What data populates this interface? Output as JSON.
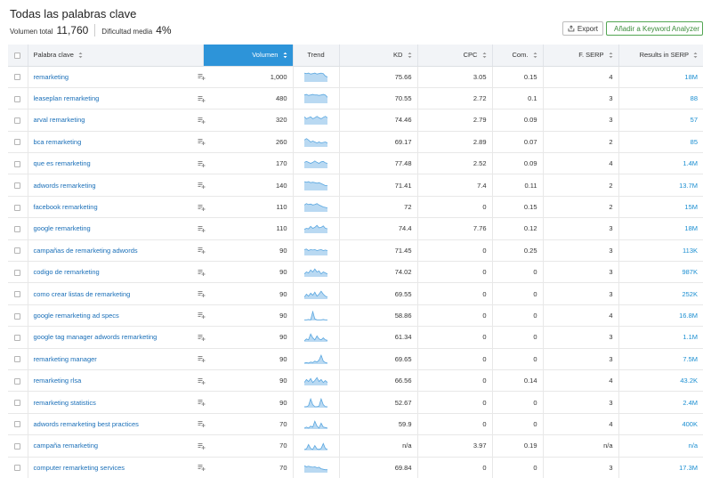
{
  "header": {
    "title": "Todas las palabras clave",
    "total_volume_label": "Volumen total",
    "total_volume_value": "11,760",
    "avg_difficulty_label": "Dificultad media",
    "avg_difficulty_value": "4%"
  },
  "toolbar": {
    "export_label": "Export",
    "add_label": "Añadir a Keyword Analyzer"
  },
  "table": {
    "columns": {
      "keyword": "Palabra clave",
      "volume": "Volumen",
      "trend": "Trend",
      "kd": "KD",
      "cpc": "CPC",
      "com": "Com.",
      "serp": "F. SERP",
      "results": "Results in SERP"
    },
    "rows": [
      {
        "keyword": "remarketing",
        "volume": "1,000",
        "kd": "75.66",
        "cpc": "3.05",
        "com": "0.15",
        "serp": "4",
        "results": "18M",
        "trend": [
          0.9,
          0.85,
          0.9,
          0.8,
          0.85,
          0.9,
          0.8,
          0.85,
          0.9,
          0.85,
          0.6,
          0.5
        ]
      },
      {
        "keyword": "leaseplan remarketing",
        "volume": "480",
        "kd": "70.55",
        "cpc": "2.72",
        "com": "0.1",
        "serp": "3",
        "results": "88",
        "trend": [
          0.85,
          0.9,
          0.8,
          0.85,
          0.9,
          0.85,
          0.85,
          0.8,
          0.85,
          0.9,
          0.85,
          0.6
        ]
      },
      {
        "keyword": "arval remarketing",
        "volume": "320",
        "kd": "74.46",
        "cpc": "2.79",
        "com": "0.09",
        "serp": "3",
        "results": "57",
        "trend": [
          0.8,
          0.6,
          0.7,
          0.8,
          0.6,
          0.7,
          0.85,
          0.7,
          0.6,
          0.75,
          0.85,
          0.7
        ]
      },
      {
        "keyword": "bca remarketing",
        "volume": "260",
        "kd": "69.17",
        "cpc": "2.89",
        "com": "0.07",
        "serp": "2",
        "results": "85",
        "trend": [
          0.7,
          0.85,
          0.7,
          0.5,
          0.6,
          0.5,
          0.4,
          0.5,
          0.4,
          0.45,
          0.5,
          0.4
        ]
      },
      {
        "keyword": "que es remarketing",
        "volume": "170",
        "kd": "77.48",
        "cpc": "2.52",
        "com": "0.09",
        "serp": "4",
        "results": "1.4M",
        "trend": [
          0.6,
          0.7,
          0.6,
          0.5,
          0.6,
          0.75,
          0.6,
          0.5,
          0.65,
          0.7,
          0.55,
          0.5
        ]
      },
      {
        "keyword": "adwords remarketing",
        "volume": "140",
        "kd": "71.41",
        "cpc": "7.4",
        "com": "0.11",
        "serp": "2",
        "results": "13.7M",
        "trend": [
          0.9,
          0.85,
          0.9,
          0.8,
          0.85,
          0.8,
          0.75,
          0.8,
          0.7,
          0.6,
          0.5,
          0.5
        ]
      },
      {
        "keyword": "facebook remarketing",
        "volume": "110",
        "kd": "72",
        "cpc": "0",
        "com": "0.15",
        "serp": "2",
        "results": "15M",
        "trend": [
          0.7,
          0.85,
          0.75,
          0.8,
          0.7,
          0.75,
          0.85,
          0.7,
          0.6,
          0.5,
          0.45,
          0.4
        ]
      },
      {
        "keyword": "google remarketing",
        "volume": "110",
        "kd": "74.4",
        "cpc": "7.76",
        "com": "0.12",
        "serp": "3",
        "results": "18M",
        "trend": [
          0.4,
          0.5,
          0.45,
          0.7,
          0.5,
          0.6,
          0.8,
          0.55,
          0.6,
          0.75,
          0.5,
          0.45
        ]
      },
      {
        "keyword": "campañas de remarketing adwords",
        "volume": "90",
        "kd": "71.45",
        "cpc": "0",
        "com": "0.25",
        "serp": "3",
        "results": "113K",
        "trend": [
          0.6,
          0.65,
          0.5,
          0.6,
          0.55,
          0.6,
          0.5,
          0.55,
          0.6,
          0.5,
          0.55,
          0.5
        ]
      },
      {
        "keyword": "codigo de remarketing",
        "volume": "90",
        "kd": "74.02",
        "cpc": "0",
        "com": "0",
        "serp": "3",
        "results": "987K",
        "trend": [
          0.3,
          0.5,
          0.4,
          0.7,
          0.5,
          0.8,
          0.5,
          0.6,
          0.3,
          0.5,
          0.4,
          0.3
        ]
      },
      {
        "keyword": "como crear listas de remarketing",
        "volume": "90",
        "kd": "69.55",
        "cpc": "0",
        "com": "0",
        "serp": "3",
        "results": "252K",
        "trend": [
          0.2,
          0.5,
          0.3,
          0.6,
          0.4,
          0.7,
          0.3,
          0.5,
          0.8,
          0.5,
          0.3,
          0.2
        ]
      },
      {
        "keyword": "google remarketing ad specs",
        "volume": "90",
        "kd": "58.86",
        "cpc": "0",
        "com": "0",
        "serp": "4",
        "results": "16.8M",
        "trend": [
          0.05,
          0.05,
          0.1,
          0.05,
          0.9,
          0.15,
          0.05,
          0.05,
          0.05,
          0.1,
          0.05,
          0.05
        ]
      },
      {
        "keyword": "google tag manager adwords remarketing",
        "volume": "90",
        "kd": "61.34",
        "cpc": "0",
        "com": "0",
        "serp": "3",
        "results": "1.1M",
        "trend": [
          0.1,
          0.3,
          0.2,
          0.8,
          0.4,
          0.2,
          0.6,
          0.3,
          0.2,
          0.4,
          0.2,
          0.15
        ]
      },
      {
        "keyword": "remarketing manager",
        "volume": "90",
        "kd": "69.65",
        "cpc": "0",
        "com": "0",
        "serp": "3",
        "results": "7.5M",
        "trend": [
          0.1,
          0.15,
          0.1,
          0.2,
          0.15,
          0.3,
          0.2,
          0.4,
          0.9,
          0.3,
          0.15,
          0.1
        ]
      },
      {
        "keyword": "remarketing rlsa",
        "volume": "90",
        "kd": "66.56",
        "cpc": "0",
        "com": "0.14",
        "serp": "4",
        "results": "43.2K",
        "trend": [
          0.3,
          0.6,
          0.4,
          0.7,
          0.3,
          0.5,
          0.8,
          0.4,
          0.6,
          0.3,
          0.5,
          0.3
        ]
      },
      {
        "keyword": "remarketing statistics",
        "volume": "90",
        "kd": "52.67",
        "cpc": "0",
        "com": "0",
        "serp": "3",
        "results": "2.4M",
        "trend": [
          0.1,
          0.1,
          0.2,
          0.9,
          0.3,
          0.1,
          0.1,
          0.15,
          0.9,
          0.3,
          0.1,
          0.1
        ]
      },
      {
        "keyword": "adwords remarketing best practices",
        "volume": "70",
        "kd": "59.9",
        "cpc": "0",
        "com": "0",
        "serp": "4",
        "results": "400K",
        "trend": [
          0.1,
          0.2,
          0.1,
          0.3,
          0.2,
          0.8,
          0.3,
          0.1,
          0.6,
          0.2,
          0.15,
          0.1
        ]
      },
      {
        "keyword": "campaña remarketing",
        "volume": "70",
        "kd": "n/a",
        "cpc": "3.97",
        "com": "0.19",
        "serp": "n/a",
        "results": "n/a",
        "trend": [
          0.1,
          0.15,
          0.6,
          0.2,
          0.1,
          0.5,
          0.15,
          0.1,
          0.2,
          0.7,
          0.2,
          0.1
        ]
      },
      {
        "keyword": "computer remarketing services",
        "volume": "70",
        "kd": "69.84",
        "cpc": "0",
        "com": "0",
        "serp": "3",
        "results": "17.3M",
        "trend": [
          0.7,
          0.6,
          0.65,
          0.6,
          0.55,
          0.6,
          0.5,
          0.55,
          0.4,
          0.35,
          0.3,
          0.3
        ]
      }
    ]
  },
  "colors": {
    "accent": "#2d94d9",
    "link": "#1a6fb8",
    "trend_fill": "#b9d9f2",
    "trend_stroke": "#5aa7e0",
    "add_button": "#3a8c3a"
  },
  "icons": {
    "export": "export-icon",
    "add": "plus-icon",
    "add_to_list": "add-to-list-icon",
    "sort": "sort-arrows-icon"
  }
}
